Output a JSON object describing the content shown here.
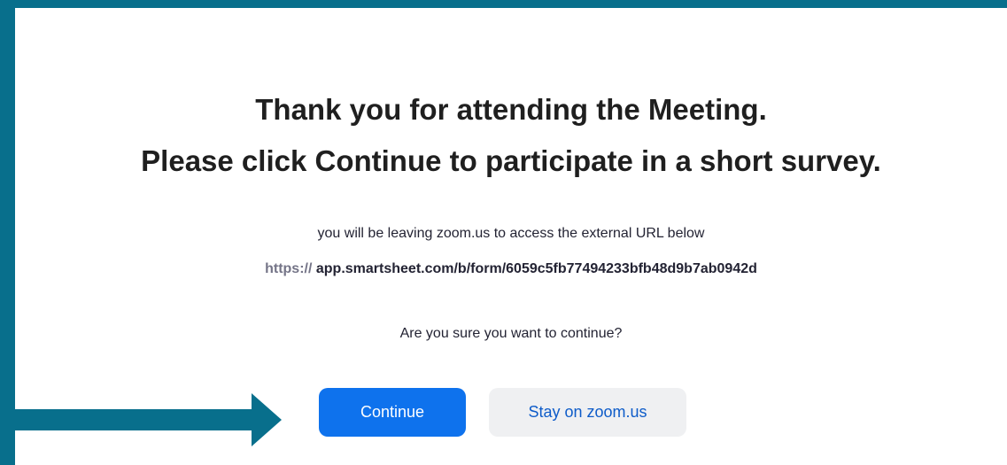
{
  "heading": {
    "line1": "Thank you for attending the Meeting.",
    "line2": "Please click Continue to participate in a short survey."
  },
  "message": {
    "leaving_text": "you will be leaving zoom.us to access the external URL below",
    "url_scheme": "https://",
    "url_rest": "app.smartsheet.com/b/form/6059c5fb77494233bfb48d9b7ab0942d",
    "question": "Are you sure you want to continue?"
  },
  "buttons": {
    "continue_label": "Continue",
    "stay_label": "Stay on zoom.us"
  },
  "annotation": {
    "arrow_icon": "right-arrow-icon",
    "arrow_color": "#086f8c"
  },
  "colors": {
    "frame": "#086f8c",
    "primary_button": "#0e72ed",
    "secondary_button_bg": "#eff0f2",
    "secondary_button_text": "#0e5cc9"
  }
}
